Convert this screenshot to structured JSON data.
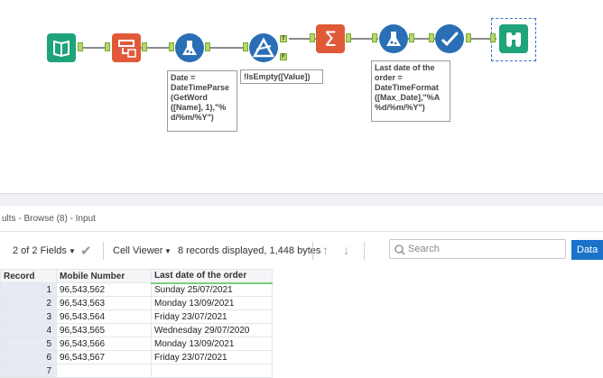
{
  "workflow": {
    "annotations": {
      "formula1": "Date =\nDateTimeParse\n(GetWord\n([Name], 1),\"%\nd/%m/%Y\")",
      "filter": "!IsEmpty([Value])",
      "formula2": "Last date of the\norder =\nDateTimeFormat\n([Max_Date],\"%A\n%d/%m/%Y\")"
    },
    "filter_true": "T",
    "filter_false": "F",
    "tools": [
      "input-icon",
      "text-to-columns-icon",
      "formula-icon",
      "filter-icon",
      "summarize-icon",
      "formula-icon",
      "select-icon",
      "browse-icon"
    ],
    "colors": {
      "input": "#1fa37a",
      "parse": "#e05a3a",
      "formula": "#2a6fb5",
      "filter": "#2a6fb5",
      "summarize": "#e05a3a",
      "select": "#2a6fb5",
      "browse": "#1fa37a"
    }
  },
  "results": {
    "title": "ults - Browse (8) - Input",
    "fields": "2 of 2 Fields",
    "viewer": "Cell Viewer",
    "summary": "8 records displayed, 1,448 bytes",
    "search_placeholder": "Search",
    "data_button": "Data",
    "columns": [
      "Record",
      "Mobile Number",
      "Last date of the order"
    ],
    "rows": [
      [
        "1",
        "96,543,562",
        "Sunday 25/07/2021"
      ],
      [
        "2",
        "96,543,563",
        "Monday 13/09/2021"
      ],
      [
        "3",
        "96,543,564",
        "Friday 23/07/2021"
      ],
      [
        "4",
        "96,543,565",
        "Wednesday 29/07/2020"
      ],
      [
        "5",
        "96,543,566",
        "Monday 13/09/2021"
      ],
      [
        "6",
        "96,543,567",
        "Friday 23/07/2021"
      ],
      [
        "7",
        "",
        ""
      ]
    ]
  }
}
